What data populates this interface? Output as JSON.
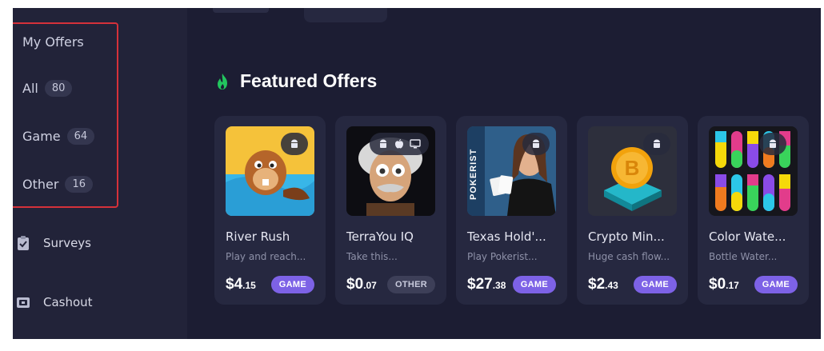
{
  "colors": {
    "background": "#1c1d33",
    "sidebar": "#222339",
    "card": "#262840",
    "highlight_box": "#d5313a",
    "accent_green": "#22c55e",
    "badge_game": "#7d62e6",
    "badge_other": "#3d3f58"
  },
  "sidebar": {
    "heading": "My Offers",
    "filters": [
      {
        "label": "All",
        "count": "80"
      },
      {
        "label": "Game",
        "count": "64"
      },
      {
        "label": "Other",
        "count": "16"
      }
    ],
    "nav": [
      {
        "label": "Surveys",
        "icon": "clipboard-icon"
      },
      {
        "label": "Cashout",
        "icon": "wallet-icon"
      }
    ]
  },
  "main": {
    "section_title": "Featured Offers",
    "section_icon": "flame-icon",
    "offers": [
      {
        "title": "River Rush",
        "desc": "Play and reach...",
        "price_main": "$4",
        "price_cents": ".15",
        "badge": "GAME",
        "platforms": [
          "android-icon"
        ]
      },
      {
        "title": "TerraYou IQ",
        "desc": "Take this...",
        "price_main": "$0",
        "price_cents": ".07",
        "badge": "OTHER",
        "platforms": [
          "android-icon",
          "apple-icon",
          "desktop-icon"
        ]
      },
      {
        "title": "Texas Hold'...",
        "desc": "Play Pokerist...",
        "price_main": "$27",
        "price_cents": ".38",
        "badge": "GAME",
        "platforms": [
          "android-icon"
        ],
        "thumb_text": "POKERIST"
      },
      {
        "title": "Crypto Min...",
        "desc": "Huge cash flow...",
        "price_main": "$2",
        "price_cents": ".43",
        "badge": "GAME",
        "platforms": [
          "android-icon"
        ]
      },
      {
        "title": "Color Wate...",
        "desc": "Bottle Water...",
        "price_main": "$0",
        "price_cents": ".17",
        "badge": "GAME",
        "platforms": [
          "android-icon"
        ]
      }
    ]
  }
}
